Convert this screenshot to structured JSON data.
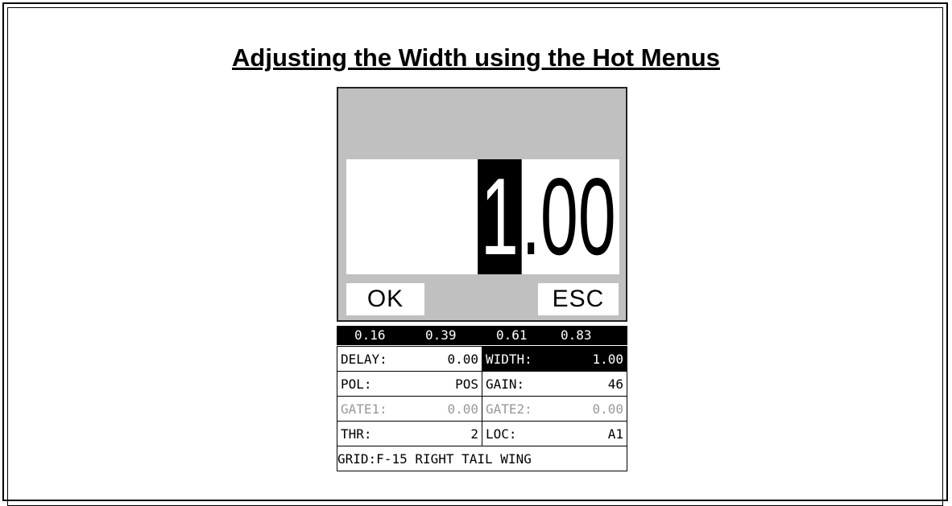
{
  "page": {
    "title": "Adjusting the Width using the Hot Menus"
  },
  "editor": {
    "selected_digit": "1",
    "rest_of_value": ".00",
    "ok_label": "OK",
    "esc_label": "ESC"
  },
  "scale": [
    "0.16",
    "0.39",
    "0.61",
    "0.83"
  ],
  "params": [
    [
      {
        "label": "DELAY:",
        "value": "0.00"
      },
      {
        "label": "WIDTH:",
        "value": "1.00",
        "selected": true
      }
    ],
    [
      {
        "label": "POL:",
        "value": "POS"
      },
      {
        "label": "GAIN:",
        "value": "46"
      }
    ],
    [
      {
        "label": "GATE1:",
        "value": "0.00",
        "disabled": true
      },
      {
        "label": "GATE2:",
        "value": "0.00",
        "disabled": true
      }
    ],
    [
      {
        "label": "THR:",
        "value": "2"
      },
      {
        "label": "LOC:",
        "value": "A1"
      }
    ]
  ],
  "grid": {
    "label": "GRID:",
    "value": "F-15 RIGHT TAIL WING"
  },
  "colors": {
    "screen_bg": "#c0c0c0",
    "selected_bg": "#000000",
    "disabled_text": "#999999"
  }
}
